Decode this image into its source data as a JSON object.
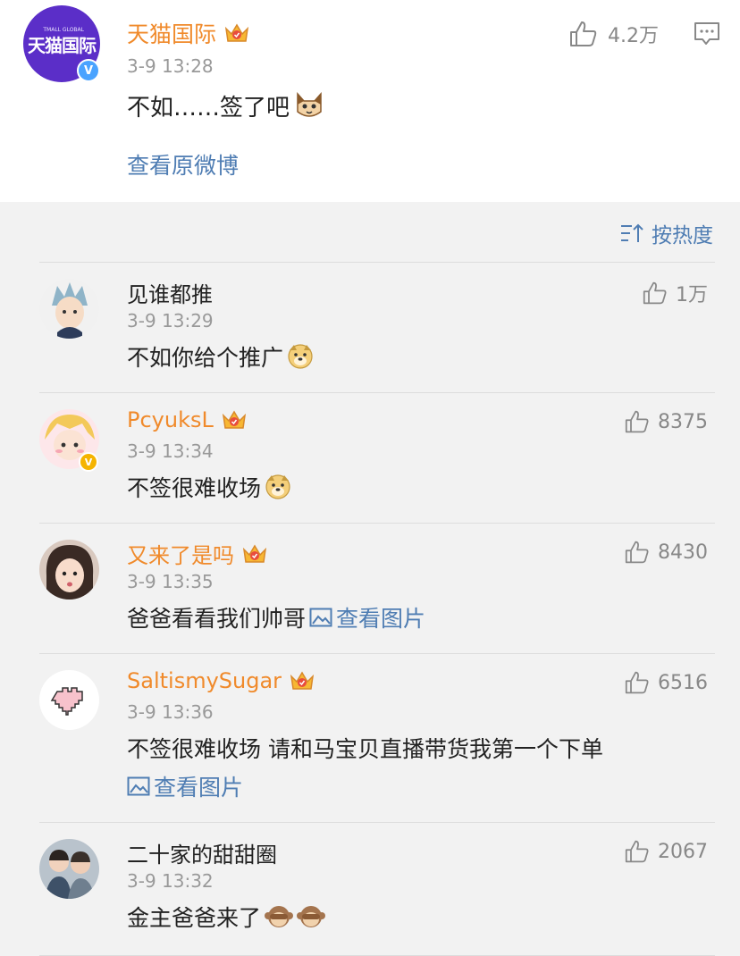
{
  "post": {
    "avatar_logo": "天猫国际",
    "avatar_logo_sub": "TMALL GLOBAL",
    "verified_mark": "V",
    "name": "天猫国际",
    "time": "3-9 13:28",
    "text": "不如……签了吧",
    "emoji": "cat-face-emoji",
    "likes": "4.2万",
    "view_original": "查看原微博"
  },
  "sort": {
    "label": "按热度",
    "icon": "sort-icon"
  },
  "comments": [
    {
      "name": "见谁都推",
      "vip": false,
      "time": "3-9 13:29",
      "text": "不如你给个推广",
      "emoji": "doge-emoji",
      "likes": "1万",
      "avatar": "anime-boy-avatar"
    },
    {
      "name": "PcyuksL",
      "vip": true,
      "verified": true,
      "time": "3-9 13:34",
      "text": "不签很难收场",
      "emoji": "doge-emoji",
      "likes": "8375",
      "avatar": "blonde-anime-avatar"
    },
    {
      "name": "又来了是吗",
      "vip": true,
      "time": "3-9 13:35",
      "text": "爸爸看看我们帅哥",
      "pic_link": "查看图片",
      "likes": "8430",
      "avatar": "girl-photo-avatar"
    },
    {
      "name": "SaltismySugar",
      "vip": true,
      "time": "3-9 13:36",
      "text": "不签很难收场 请和马宝贝直播带货我第一个下单",
      "pic_link": "查看图片",
      "likes": "6516",
      "avatar": "pixel-heart-avatar"
    },
    {
      "name": "二十家的甜甜圈",
      "vip": false,
      "time": "3-9 13:32",
      "text": "金主爸爸来了",
      "emoji": "monkey-emoji",
      "likes": "2067",
      "avatar": "two-boys-photo-avatar"
    }
  ],
  "colors": {
    "vip_name": "#f08a2b",
    "link": "#4f7db3",
    "avatar_bg": "#5b2ec8",
    "verified": "#4aa3ff"
  }
}
